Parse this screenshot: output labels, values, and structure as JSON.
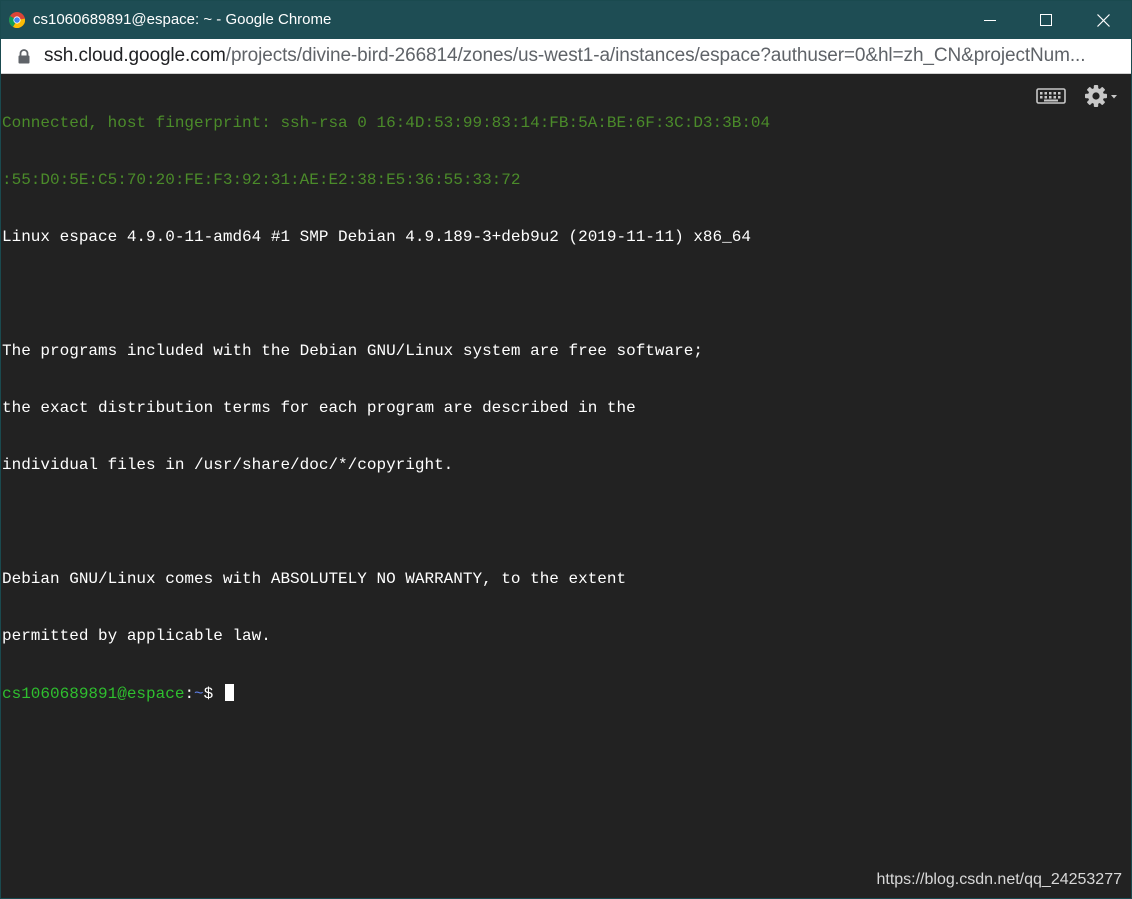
{
  "window": {
    "title": "cs1060689891@espace: ~ - Google Chrome",
    "controls": {
      "minimize_icon": "minimize-icon",
      "maximize_icon": "maximize-icon",
      "close_icon": "close-icon"
    }
  },
  "address_bar": {
    "icon": "lock-icon",
    "url_host": "ssh.cloud.google.com",
    "url_path": "/projects/divine-bird-266814/zones/us-west1-a/instances/espace?authuser=0&hl=zh_CN&projectNum..."
  },
  "terminal": {
    "lines": [
      "Connected, host fingerprint: ssh-rsa 0 16:4D:53:99:83:14:FB:5A:BE:6F:3C:D3:3B:04",
      ":55:D0:5E:C5:70:20:FE:F3:92:31:AE:E2:38:E5:36:55:33:72",
      "Linux espace 4.9.0-11-amd64 #1 SMP Debian 4.9.189-3+deb9u2 (2019-11-11) x86_64",
      "",
      "The programs included with the Debian GNU/Linux system are free software;",
      "the exact distribution terms for each program are described in the",
      "individual files in /usr/share/doc/*/copyright.",
      "",
      "Debian GNU/Linux comes with ABSOLUTELY NO WARRANTY, to the extent",
      "permitted by applicable law."
    ],
    "prompt": {
      "user_host": "cs1060689891@espace",
      "separator": ":",
      "path": "~",
      "symbol": "$ "
    },
    "toolbar": {
      "keyboard_icon": "keyboard-icon",
      "settings_icon": "gear-icon"
    }
  },
  "watermark": "https://blog.csdn.net/qq_24253277",
  "colors": {
    "titlebar": "#1e4d54",
    "terminal_bg": "#222222",
    "connected_text": "#4b8b2a",
    "prompt_user": "#2fbf2f",
    "prompt_path": "#5e7fe6"
  }
}
